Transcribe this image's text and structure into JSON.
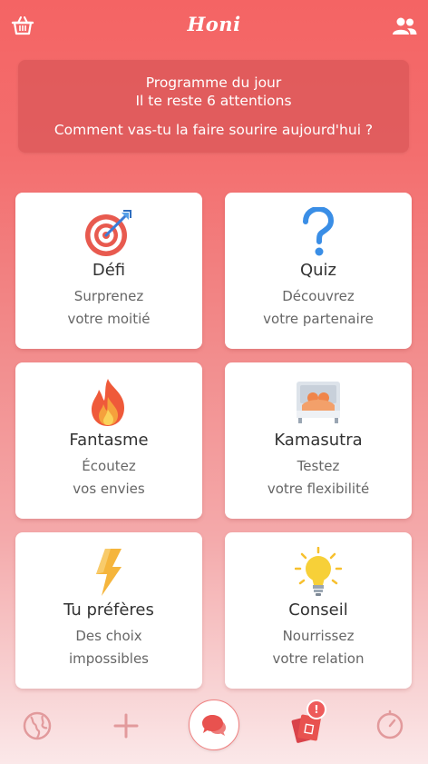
{
  "header": {
    "logo": "Honi",
    "left_icon": "basket-icon",
    "right_icon": "people-icon"
  },
  "banner": {
    "title": "Programme du jour",
    "remaining": "Il te reste 6 attentions",
    "question": "Comment vas-tu la faire sourire aujourd'hui ?"
  },
  "cards": [
    {
      "title": "Défi",
      "sub1": "Surprenez",
      "sub2": "votre moitié",
      "icon": "target-icon"
    },
    {
      "title": "Quiz",
      "sub1": "Découvrez",
      "sub2": "votre partenaire",
      "icon": "question-icon"
    },
    {
      "title": "Fantasme",
      "sub1": "Écoutez",
      "sub2": "vos envies",
      "icon": "flame-icon"
    },
    {
      "title": "Kamasutra",
      "sub1": "Testez",
      "sub2": "votre flexibilité",
      "icon": "bed-icon"
    },
    {
      "title": "Tu préfères",
      "sub1": "Des choix",
      "sub2": "impossibles",
      "icon": "lightning-icon"
    },
    {
      "title": "Conseil",
      "sub1": "Nourrissez",
      "sub2": "votre relation",
      "icon": "lightbulb-icon"
    }
  ],
  "bottom_nav": {
    "items": [
      "globe-icon",
      "plus-icon",
      "chat-icon",
      "cards-icon",
      "timer-icon"
    ],
    "badge": "!"
  },
  "colors": {
    "primary": "#f46464",
    "banner": "#d25052",
    "accent_blue": "#3a8ee6",
    "flame": "#f06a3b",
    "bolt": "#f5b53c",
    "bulb": "#f7d038"
  }
}
